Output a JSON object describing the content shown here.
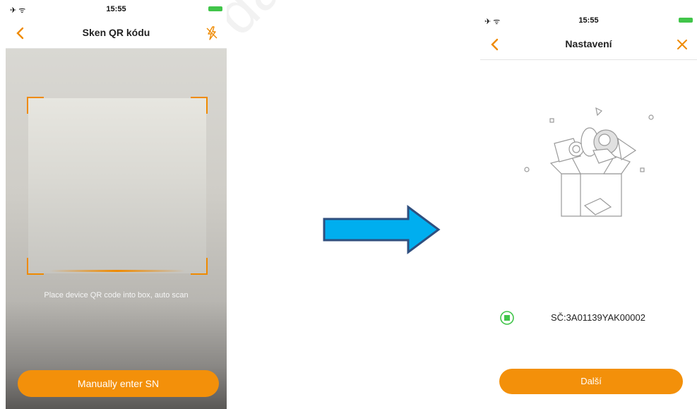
{
  "watermark": "dahua",
  "left_screen": {
    "status": {
      "left": "✈ ᯤ",
      "time": "15:55"
    },
    "nav": {
      "title": "Sken QR kódu"
    },
    "hint": "Place device QR code into box, auto scan",
    "button": "Manually enter SN"
  },
  "right_screen": {
    "status": {
      "left": "✈ ᯤ",
      "time": "15:55"
    },
    "nav": {
      "title": "Nastavení"
    },
    "serial": "SČ:3A01139YAK00002",
    "button": "Další"
  },
  "colors": {
    "accent": "#f3900a",
    "arrow": "#00aeef",
    "arrow_border": "#2f4f7f",
    "success": "#41c54a"
  }
}
